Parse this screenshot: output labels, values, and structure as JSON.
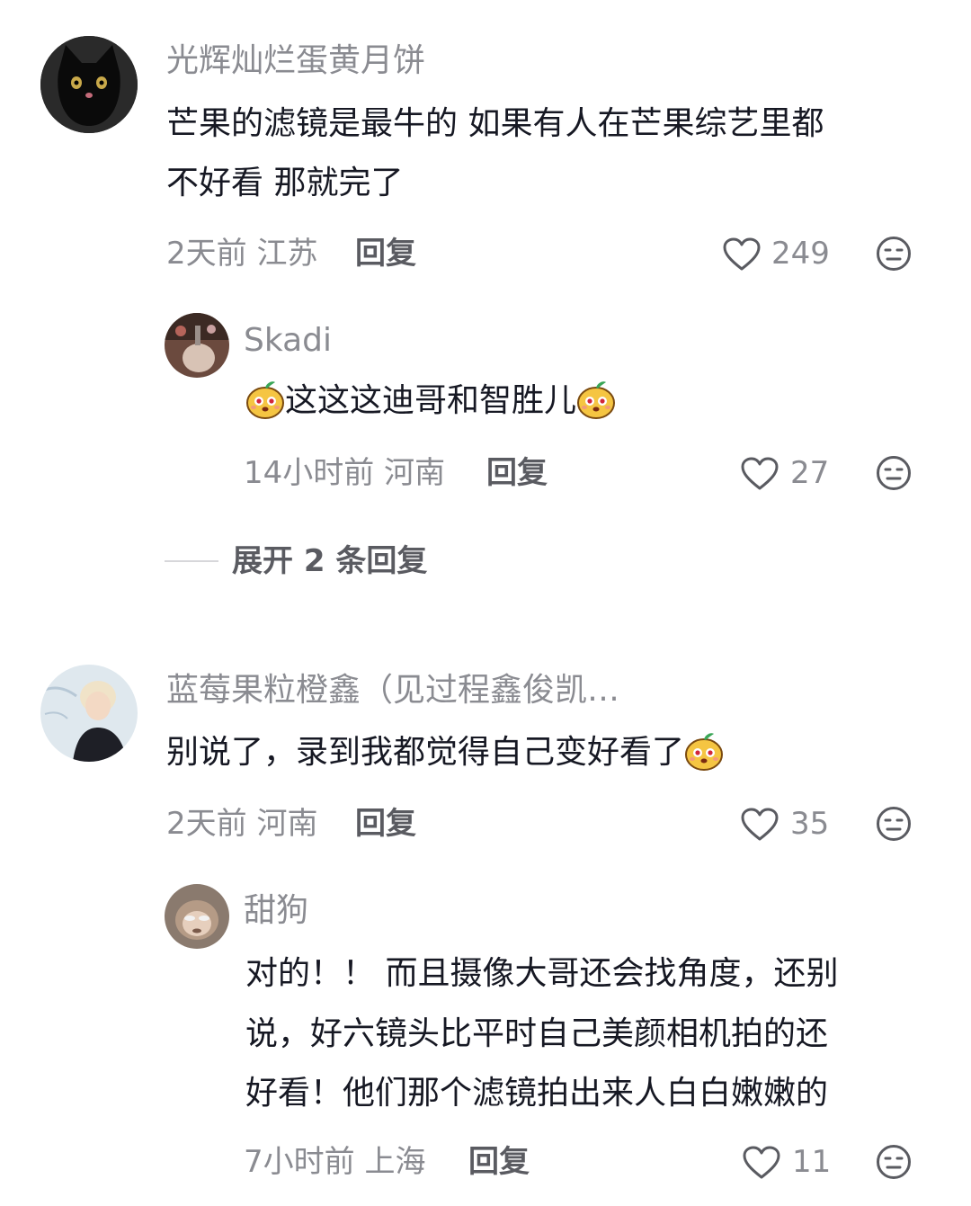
{
  "comments": [
    {
      "username": "光辉灿烂蛋黄月饼",
      "avatar": "black-cat-avatar",
      "text_line1": "芒果的滤镜是最牛的 如果有人在芒果综艺里都",
      "text_line2": "不好看 那就完了",
      "time_location": "2天前 江苏",
      "reply_label": "回复",
      "likes": "249",
      "replies": [
        {
          "username": "Skadi",
          "avatar": "photo-avatar",
          "text": "这这这迪哥和智胜儿",
          "emoji": "mango-face-emoji",
          "time_location": "14小时前 河南",
          "reply_label": "回复",
          "likes": "27"
        }
      ],
      "expand_label": "展开 2 条回复"
    },
    {
      "username": "蓝莓果粒橙鑫（见过程鑫俊凯…",
      "avatar": "portrait-avatar",
      "text": "别说了，录到我都觉得自己变好看了",
      "emoji": "mango-face-emoji",
      "time_location": "2天前 河南",
      "reply_label": "回复",
      "likes": "35",
      "replies": [
        {
          "username": "甜狗",
          "avatar": "monkey-avatar",
          "text_line1": "对的！！ 而且摄像大哥还会找角度，还别",
          "text_line2": "说，好六镜头比平时自己美颜相机拍的还",
          "text_line3": "好看！他们那个滤镜拍出来人白白嫩嫩的",
          "time_location": "7小时前 上海",
          "reply_label": "回复",
          "likes": "11"
        }
      ]
    }
  ],
  "colors": {
    "primary_text": "#161823",
    "secondary_text": "#8a8b91",
    "reply_text": "#5a5b61"
  }
}
